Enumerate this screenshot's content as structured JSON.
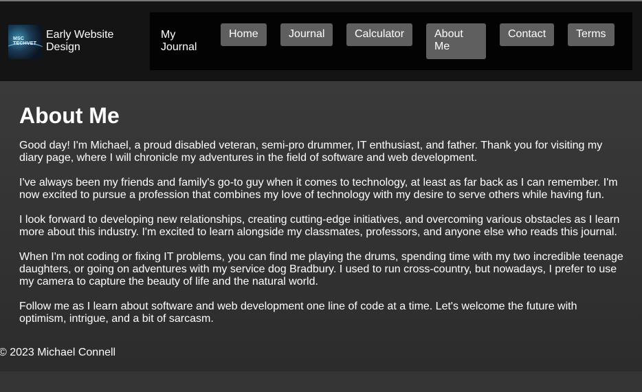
{
  "brand": {
    "logo_text": "MSC\nTECHVET",
    "title": "Early Website Design"
  },
  "nav": {
    "site_name": "My Journal",
    "items": [
      {
        "label": "Home"
      },
      {
        "label": "Journal"
      },
      {
        "label": "Calculator"
      },
      {
        "label": "About Me"
      },
      {
        "label": "Contact"
      },
      {
        "label": "Terms"
      }
    ]
  },
  "main": {
    "heading": "About Me",
    "paragraphs": [
      "Good day! I'm Michael, a proud disabled veteran, semi-pro drummer, IT enthusiast, and father. Thank you for visiting my diary page, where I will chronicle my adventures in the field of software and web development.",
      "I've always been my friends and family's go-to guy when it comes to technology, at least as far back as I can remember. I'm now excited to pursue a profession that combines my love of technology with my desire to serve others while having fun.",
      "I look forward to developing new relationships, creating cutting-edge initiatives, and overcoming various obstacles as I learn more about this industry. I'm excited to learn alongside my classmates, professors, and anyone else who reads this journal.",
      "When I'm not coding or fixing IT problems, you can find me playing the drums, spending time with my two incredible teenage daughters, or going on adventures with my service dog Bradbury. I used to run cross-country, but nowadays, I prefer to use my camera to capture the beauty of life and the natural world.",
      "Follow me as I learn about software and web development one line of code at a time. Let's welcome the future with optimism, intrigue, and a bit of sarcasm."
    ]
  },
  "footer": {
    "copyright": "© 2023 Michael Connell"
  }
}
